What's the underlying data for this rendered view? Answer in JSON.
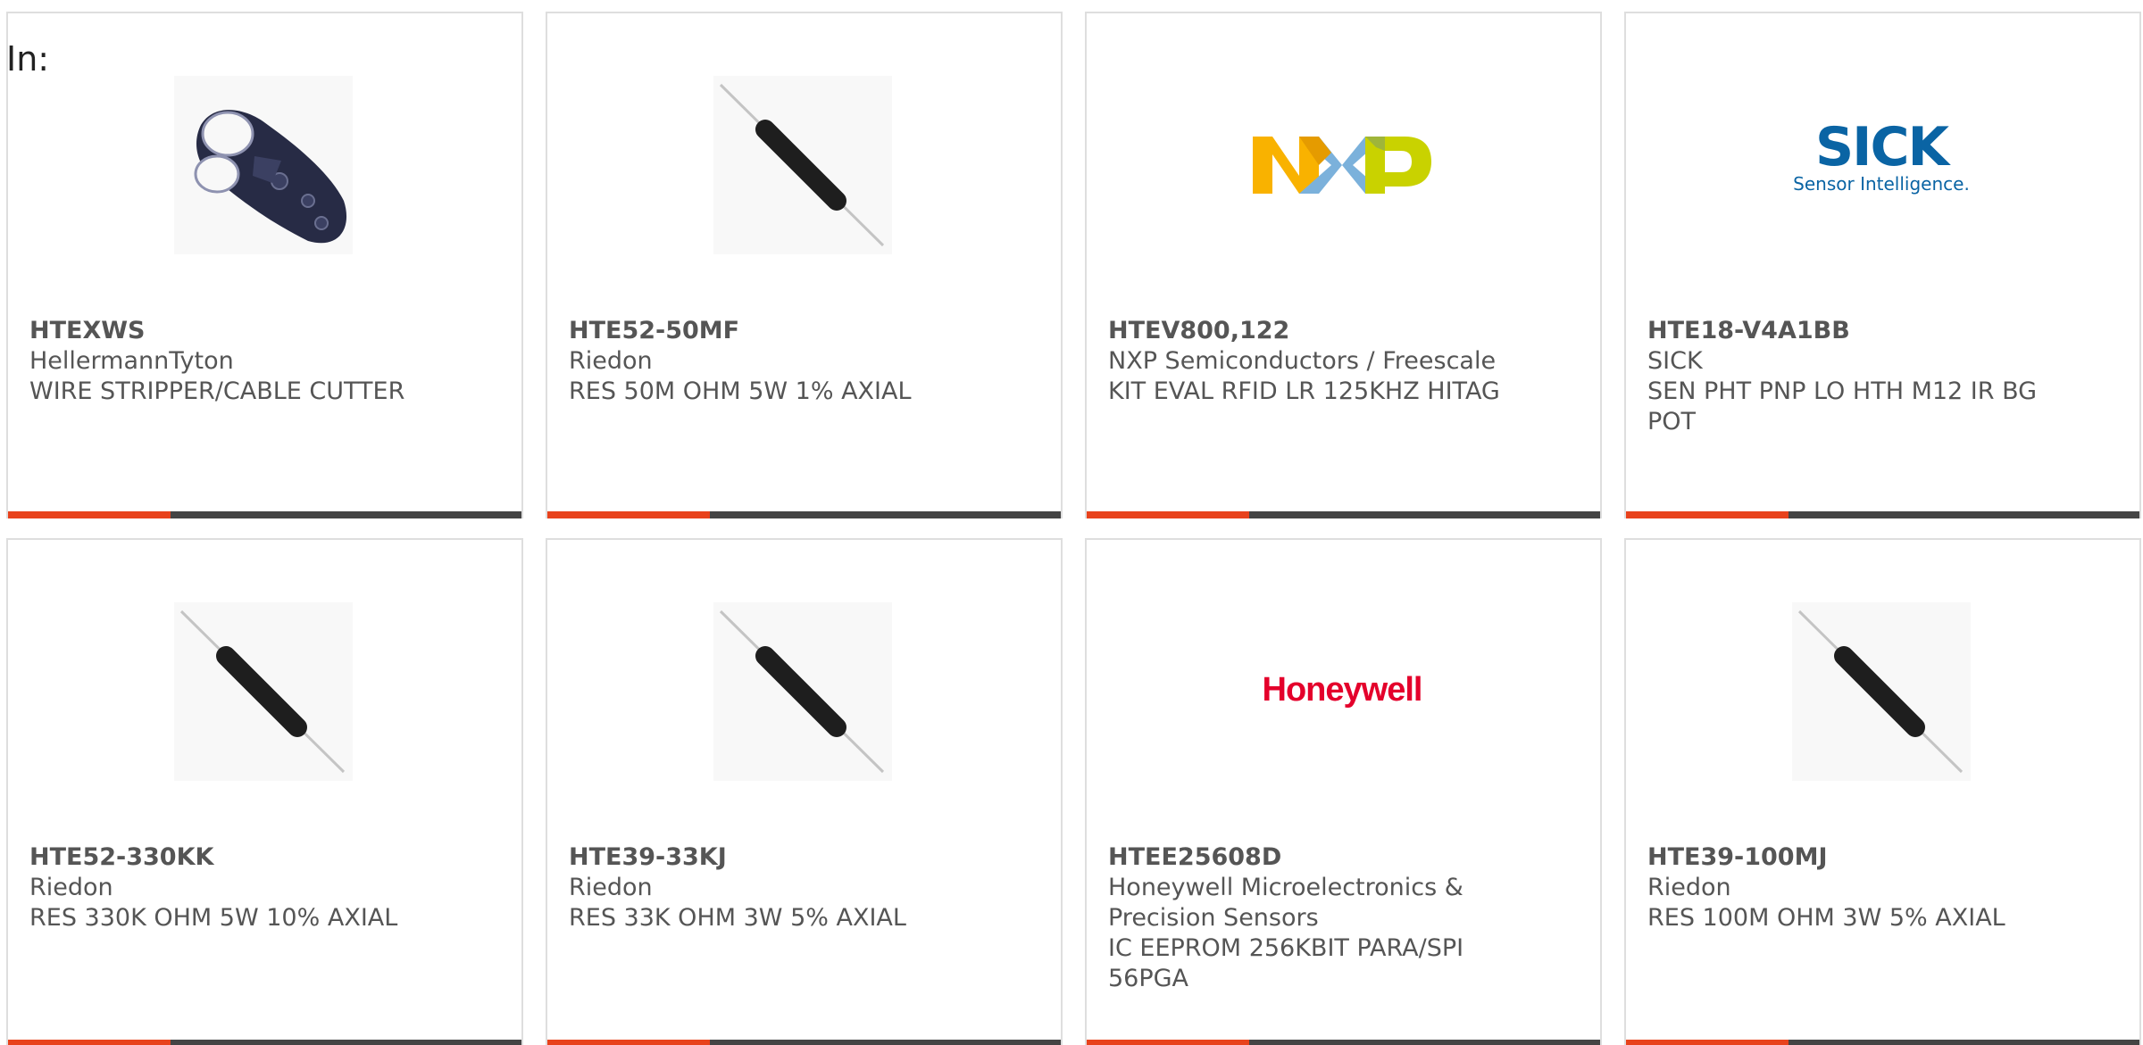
{
  "page": {
    "label": "In:"
  },
  "products": [
    {
      "part_number": "HTEXWS",
      "manufacturer": "HellermannTyton",
      "description": "WIRE STRIPPER/CABLE CUTTER",
      "image_kind": "wire-stripper-photo"
    },
    {
      "part_number": "HTE52-50MF",
      "manufacturer": "Riedon",
      "description": "RES 50M OHM 5W 1% AXIAL",
      "image_kind": "resistor-photo"
    },
    {
      "part_number": "HTEV800,122",
      "manufacturer": "NXP Semiconductors / Freescale",
      "description": "KIT EVAL RFID LR 125KHZ HITAG",
      "image_kind": "nxp-logo"
    },
    {
      "part_number": "HTE18-V4A1BB",
      "manufacturer": "SICK",
      "description": "SEN PHT PNP LO HTH M12 IR BG POT",
      "image_kind": "sick-logo"
    },
    {
      "part_number": "HTE52-330KK",
      "manufacturer": "Riedon",
      "description": "RES 330K OHM 5W 10% AXIAL",
      "image_kind": "resistor-photo"
    },
    {
      "part_number": "HTE39-33KJ",
      "manufacturer": "Riedon",
      "description": "RES 33K OHM 3W 5% AXIAL",
      "image_kind": "resistor-photo"
    },
    {
      "part_number": "HTEE25608D",
      "manufacturer": "Honeywell Microelectronics & Precision Sensors",
      "description": "IC EEPROM 256KBIT PARA/SPI 56PGA",
      "image_kind": "honeywell-logo"
    },
    {
      "part_number": "HTE39-100MJ",
      "manufacturer": "Riedon",
      "description": "RES 100M OHM 3W 5% AXIAL",
      "image_kind": "resistor-photo"
    }
  ],
  "logos": {
    "nxp": {
      "letters": [
        "N",
        "X",
        "P"
      ],
      "colors": [
        "#f9b200",
        "#7bb1db",
        "#c9d200"
      ]
    },
    "sick": {
      "name": "SICK",
      "tagline": "Sensor Intelligence.",
      "color": "#0a64a4"
    },
    "honeywell": {
      "name": "Honeywell",
      "color": "#e4002b"
    }
  },
  "colors": {
    "accent_bar": "#e8421c",
    "dark_bar": "#444444",
    "text": "#555555",
    "card_border": "#dedede"
  }
}
